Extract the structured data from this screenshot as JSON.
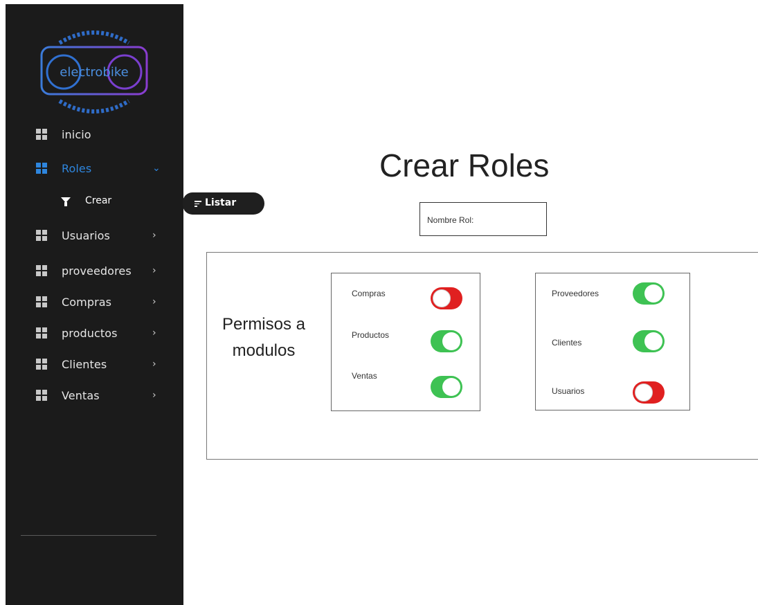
{
  "sidebar": {
    "logo_text": "electrobike",
    "items": [
      {
        "label": "inicio",
        "chevron": ""
      },
      {
        "label": "Roles",
        "chevron": "⌄"
      },
      {
        "label": "Usuarios",
        "chevron": "›"
      },
      {
        "label": "proveedores",
        "chevron": "›"
      },
      {
        "label": "Compras",
        "chevron": "›"
      },
      {
        "label": "productos",
        "chevron": "›"
      },
      {
        "label": "Clientes",
        "chevron": "›"
      },
      {
        "label": "Ventas",
        "chevron": "›"
      }
    ],
    "active_item": "Roles",
    "sub_item": {
      "label": "Crear",
      "icon": "filter-icon"
    }
  },
  "listar_button": {
    "label": "Listar",
    "icon": "sort-lines-icon"
  },
  "page": {
    "title": "Crear Roles",
    "name_field_label": "Nombre Rol:"
  },
  "permissions": {
    "title_line1": "Permisos a",
    "title_line2": "modulos",
    "group_a": [
      {
        "label": "Compras",
        "enabled": false
      },
      {
        "label": "Productos",
        "enabled": true
      },
      {
        "label": "Ventas",
        "enabled": true
      }
    ],
    "group_b": [
      {
        "label": "Proveedores",
        "enabled": true
      },
      {
        "label": "Clientes",
        "enabled": true
      },
      {
        "label": "Usuarios",
        "enabled": false
      }
    ]
  },
  "colors": {
    "sidebar_bg": "#1b1b1b",
    "accent": "#2e86de",
    "toggle_on": "#3ec253",
    "toggle_off": "#e02020"
  }
}
